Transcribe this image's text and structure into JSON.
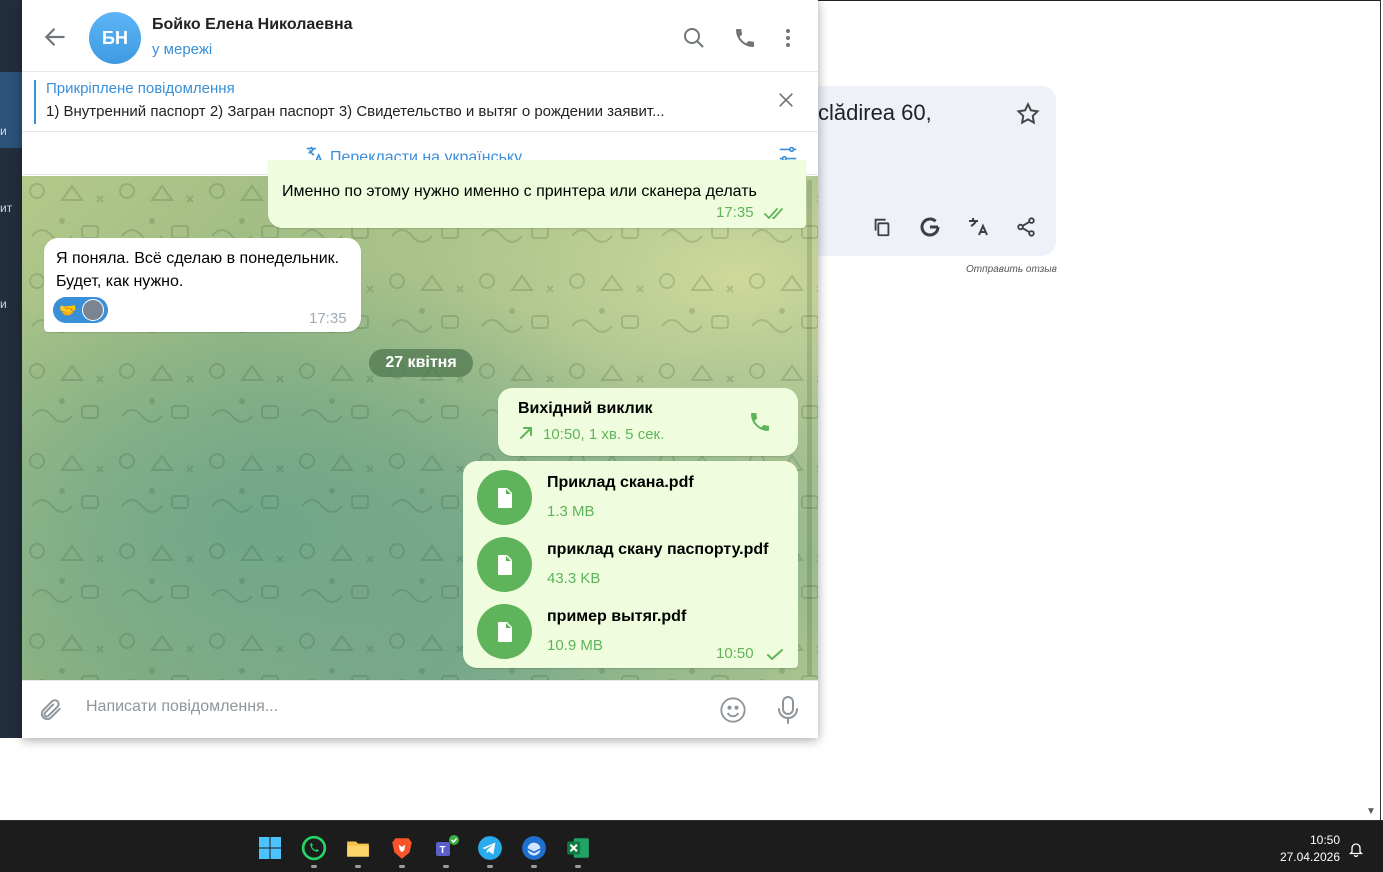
{
  "window": {
    "contact_name": "Бойко Елена Николаевна",
    "avatar_initials": "БН",
    "status": "у мережі"
  },
  "pinned": {
    "title": "Прикріплене повідомлення",
    "text": "1) Внутренний паспорт 2) Загран паспорт 3) Свидетельство и вытяг о рождении заявит..."
  },
  "translate": {
    "label": "Перекласти на українську"
  },
  "messages": [
    {
      "direction": "out",
      "text": "Именно по этому нужно именно с принтера или сканера делать",
      "time": "17:35",
      "status": "read"
    },
    {
      "direction": "in",
      "lines": [
        "Я поняла. Всё сделаю в понедельник.",
        "Будет, как нужно."
      ],
      "time": "17:35",
      "reaction": "handshake"
    }
  ],
  "date_separator": "27 квітня",
  "call": {
    "title": "Вихідний виклик",
    "detail": "10:50, 1 хв. 5 сек."
  },
  "files": [
    {
      "name": "Приклад скана.pdf",
      "size": "1.3 MB"
    },
    {
      "name": "приклад скану паспорту.pdf",
      "size": "43.3 KB"
    },
    {
      "name": "пример вытяг.pdf",
      "size": "10.9 MB"
    }
  ],
  "files_time": "10:50",
  "composer": {
    "placeholder": "Написати повідомлення..."
  },
  "sidebar_fragments": [
    "и",
    "ит",
    "и"
  ],
  "background": {
    "address_fragment": "clădirea 60,",
    "feedback": "Отправить отзыв"
  },
  "taskbar": {
    "time": "10:50",
    "date": "27.04.2026",
    "apps": [
      "windows-start",
      "whatsapp",
      "file-explorer",
      "brave",
      "teams",
      "telegram",
      "thunderbird",
      "excel"
    ]
  },
  "colors": {
    "accent": "#3a8fd9",
    "outgoing_bubble": "#effdde",
    "outgoing_meta": "#5fb45b",
    "sidebar": "#232e3c"
  }
}
